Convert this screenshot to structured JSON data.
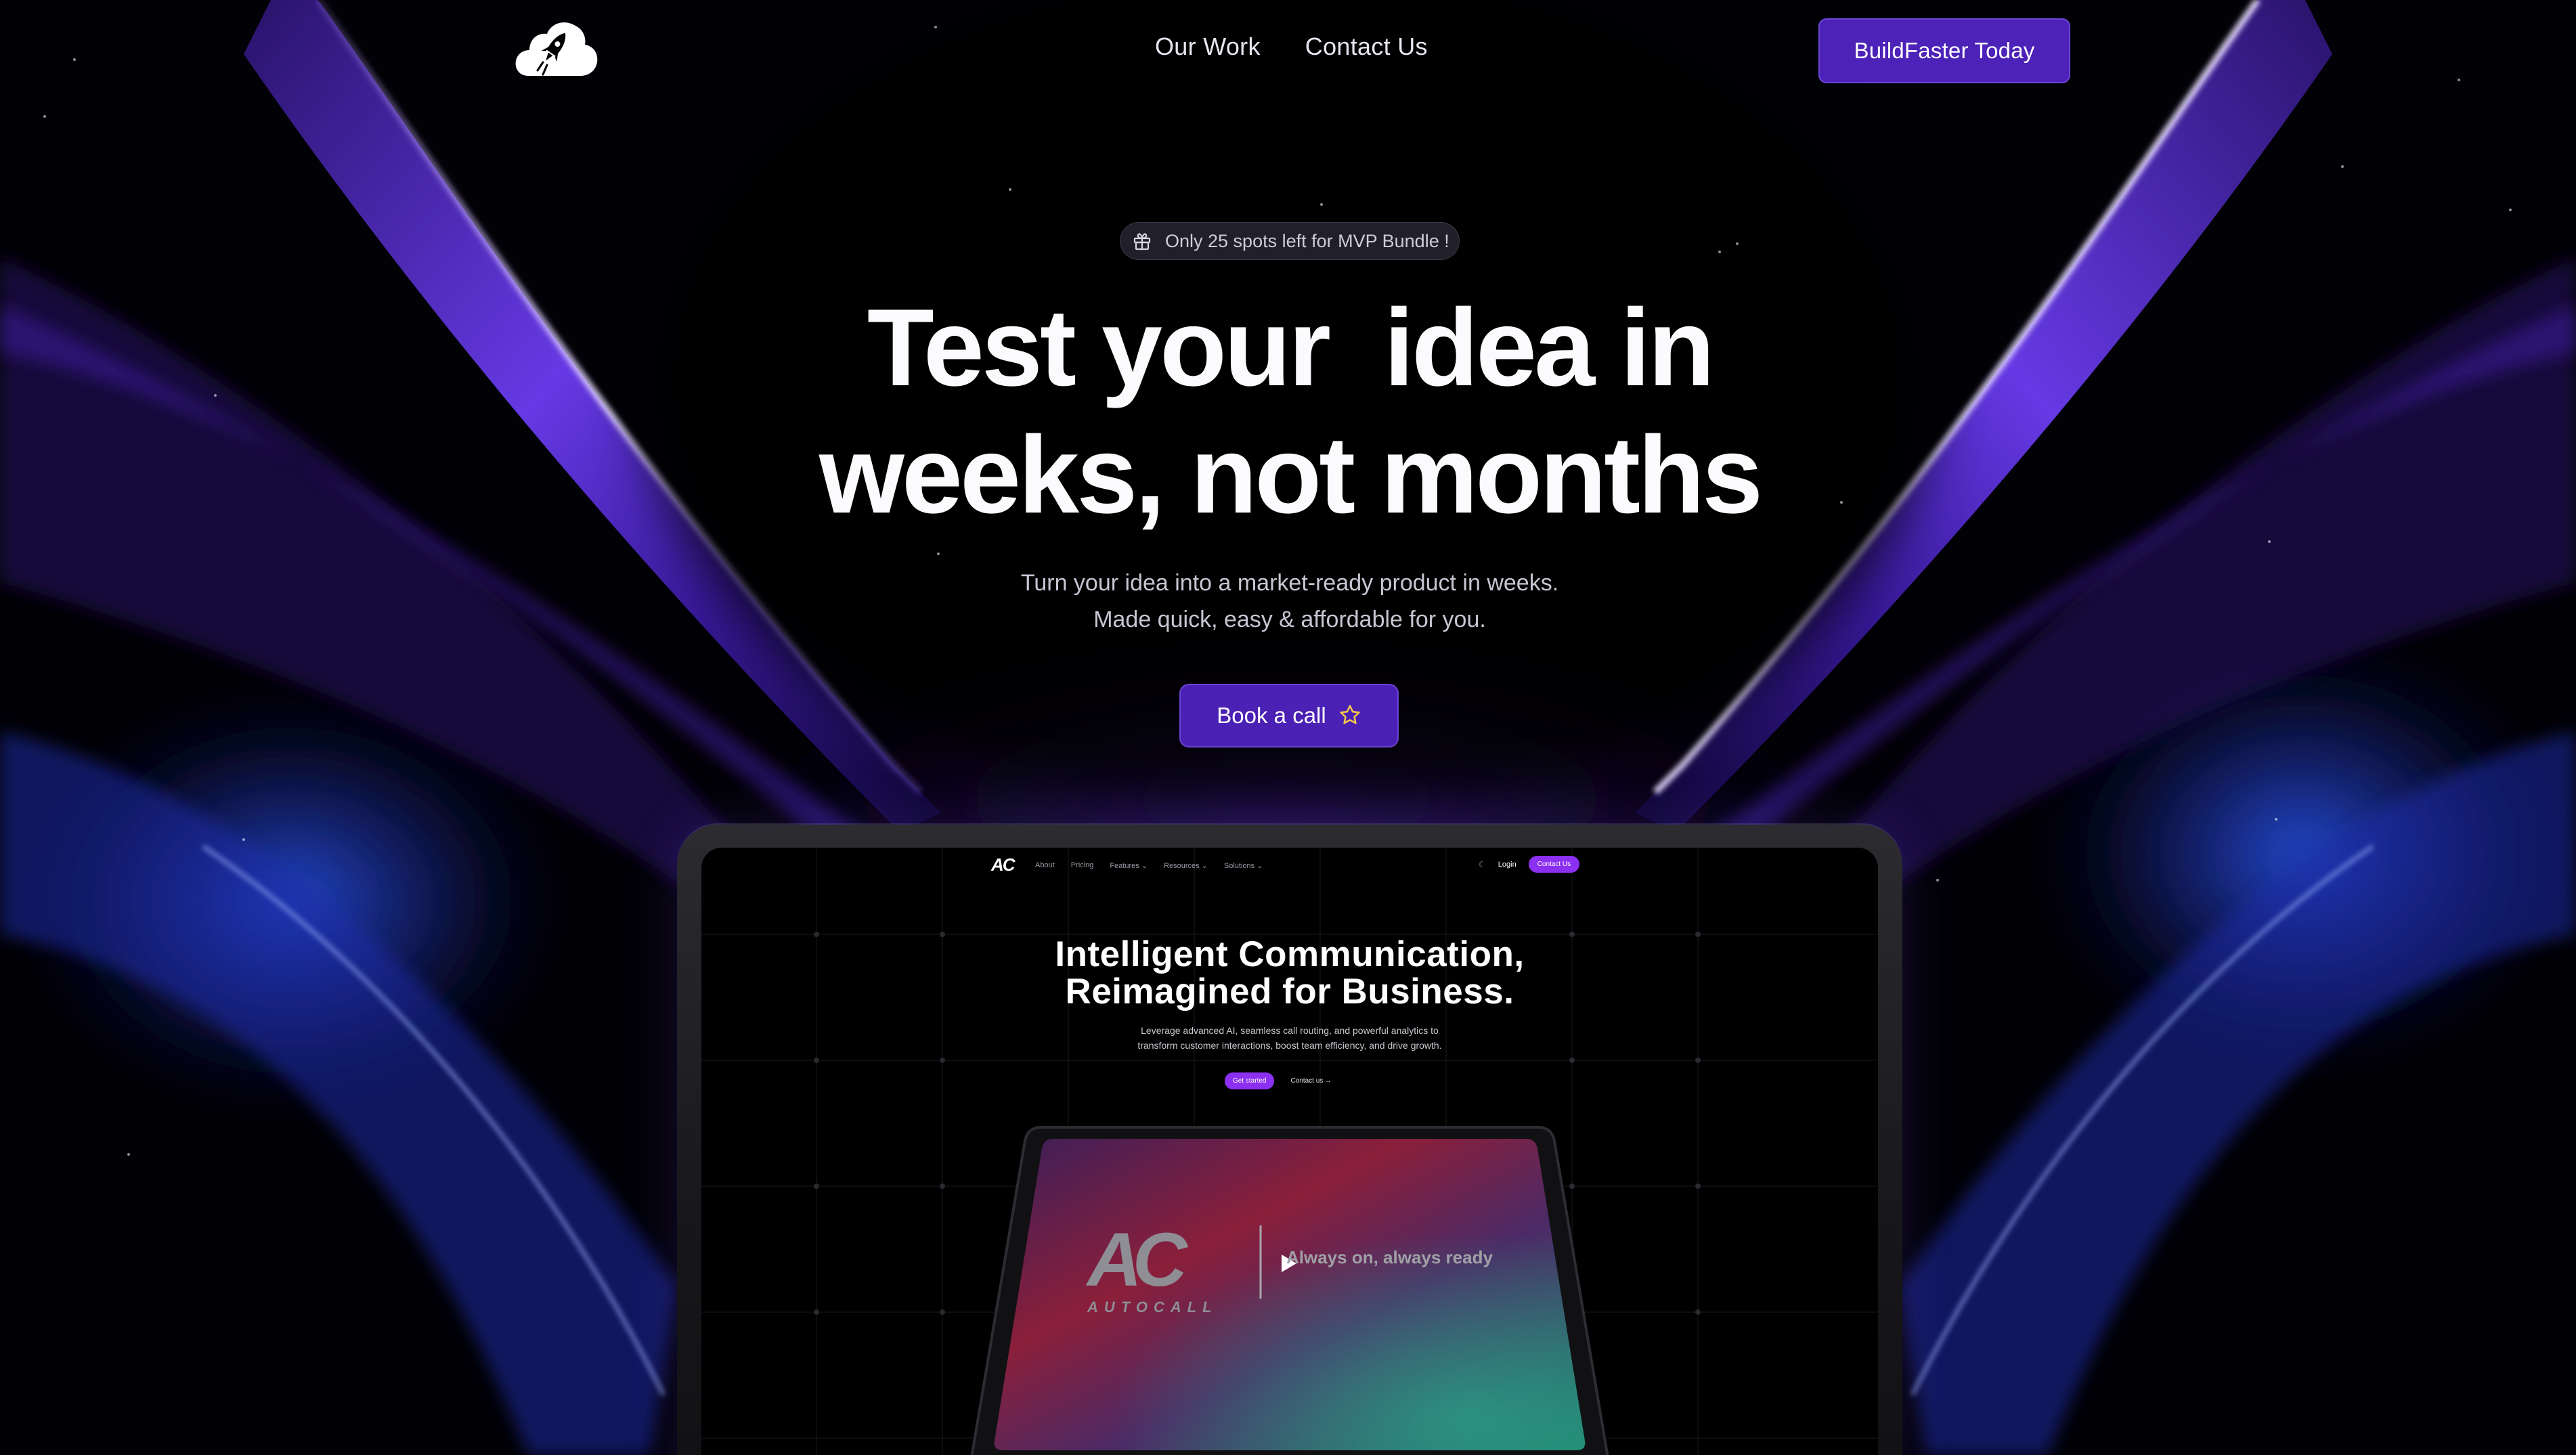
{
  "nav": {
    "logo_icon": "cloud-rocket-icon",
    "links": [
      {
        "label": "Our Work"
      },
      {
        "label": "Contact Us"
      }
    ],
    "cta_label": "BuildFaster Today"
  },
  "hero": {
    "badge_icon": "gift-icon",
    "badge_text": "Only 25 spots left for MVP Bundle !",
    "headline_line1": "Test your  idea in",
    "headline_line2": "weeks, not months",
    "subline_line1": "Turn your idea into a market-ready product in weeks.",
    "subline_line2": "Made quick, easy & affordable for you.",
    "cta_label": "Book a call",
    "cta_icon": "star-icon"
  },
  "preview": {
    "logo": "AC",
    "nav_links": [
      "About",
      "Pricing",
      "Features ⌄",
      "Resources ⌄",
      "Solutions ⌄"
    ],
    "moon_icon": "moon-icon",
    "login_label": "Login",
    "contact_label": "Contact Us",
    "title_line1": "Intelligent Communication,",
    "title_line2": "Reimagined for Business.",
    "desc_line1": "Leverage advanced AI, seamless call routing, and powerful analytics to",
    "desc_line2": "transform customer interactions, boost team efficiency, and drive growth.",
    "get_started_label": "Get started",
    "contact_link_label": "Contact us →",
    "video": {
      "brand_letters": "AC",
      "brand_word": "AUTOCALL",
      "tagline": "Always on, always ready",
      "play_icon": "play-icon"
    }
  },
  "colors": {
    "accent": "#4c22b8",
    "accent_border": "#6b45d6",
    "preview_accent": "#8b2ff0",
    "background": "#000000"
  }
}
